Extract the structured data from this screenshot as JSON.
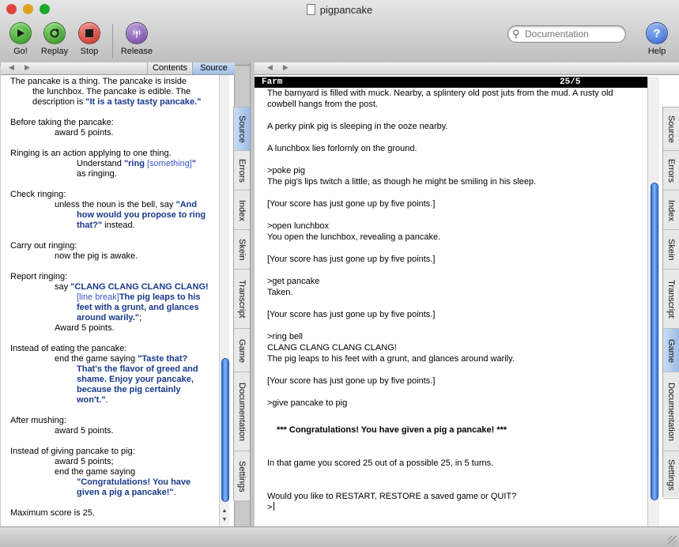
{
  "window": {
    "title": "pigpancake",
    "traffic_colors": [
      "#e0443e",
      "#dea123",
      "#1aab29"
    ]
  },
  "toolbar": {
    "go_label": "Go!",
    "replay_label": "Replay",
    "stop_label": "Stop",
    "release_label": "Release",
    "help_label": "Help",
    "search_placeholder": "Documentation"
  },
  "left_pane": {
    "tabs": {
      "contents": "Contents",
      "source": "Source"
    },
    "source": {
      "l1": "The pancake is a thing. The pancake is inside",
      "l2": "the lunchbox. The pancake is edible. The",
      "l3a": "description is ",
      "l3b": "\"It is a tasty tasty pancake.\"",
      "before1": "Before taking the pancake:",
      "before2": "award 5 points.",
      "ring1": "Ringing is an action applying to one thing.",
      "ring2a": "Understand ",
      "ring2b": "\"ring ",
      "ring2c": "[something]",
      "ring2d": "\"",
      "ring3": "as ringing.",
      "check1": "Check ringing:",
      "check2a": "unless the noun is the bell, say ",
      "check2b": "\"And",
      "check3": "how would you propose to ring",
      "check4a": "that?\"",
      "check4b": " instead.",
      "carry1": "Carry out ringing:",
      "carry2": "now the pig is awake.",
      "report1": "Report ringing:",
      "report2a": "say ",
      "report2b": "\"CLANG CLANG CLANG CLANG!",
      "report3a": "[line break]",
      "report3b": "The pig leaps to his",
      "report4": "feet with a grunt, and glances",
      "report5a": "around warily.\"",
      "report5b": ";",
      "report6": "Award 5 points.",
      "eat1": "Instead of eating the pancake:",
      "eat2a": "end the game saying ",
      "eat2b": "\"Taste that?",
      "eat3": "That's the flavor of greed and",
      "eat4": "shame. Enjoy your pancake,",
      "eat5": "because the pig certainly",
      "eat6a": "won't.\"",
      "eat6b": ".",
      "mush1": "After mushing:",
      "mush2": "award 5 points.",
      "give1": "Instead of giving pancake to pig:",
      "give2": "award 5 points;",
      "give3": "end the game saying",
      "give4": "\"Congratulations! You have",
      "give5a": "given a pig a pancake!\"",
      "give5b": ".",
      "max": "Maximum score is 25."
    },
    "side_tabs": [
      "Source",
      "Errors",
      "Index",
      "Skein",
      "Transcript",
      "Game",
      "Documentation",
      "Settings"
    ],
    "active_tab": "Source"
  },
  "right_pane": {
    "status_left": "Farm",
    "status_right": "25/5",
    "transcript": {
      "desc1": "The barnyard is filled with muck. Nearby, a splintery old post juts from the mud. A rusty old",
      "desc2": "cowbell hangs from the post.",
      "pig": "A perky pink pig is sleeping in the ooze nearby.",
      "lunchbox": "A lunchbox lies forlornly on the ground.",
      "cmd1": ">poke pig",
      "resp1": "The pig's lips twitch a little, as though he might be smiling in his sleep.",
      "score1": "[Your score has just gone up by five points.]",
      "cmd2": ">open lunchbox",
      "resp2": "You open the lunchbox, revealing a pancake.",
      "score2": "[Your score has just gone up by five points.]",
      "cmd3": ">get pancake",
      "resp3": "Taken.",
      "score3": "[Your score has just gone up by five points.]",
      "cmd4": ">ring bell",
      "resp4a": "CLANG CLANG CLANG CLANG!",
      "resp4b": "The pig leaps to his feet with a grunt, and glances around warily.",
      "score4": "[Your score has just gone up by five points.]",
      "cmd5": ">give pancake to pig",
      "congrats": "*** Congratulations! You have given a pig a pancake! ***",
      "final": "In that game you scored 25 out of a possible 25, in 5 turns.",
      "restart": "Would you like to RESTART, RESTORE a saved game or QUIT?",
      "prompt": ">"
    },
    "side_tabs": [
      "Source",
      "Errors",
      "Index",
      "Skein",
      "Transcript",
      "Game",
      "Documentation",
      "Settings"
    ],
    "active_tab": "Game"
  }
}
